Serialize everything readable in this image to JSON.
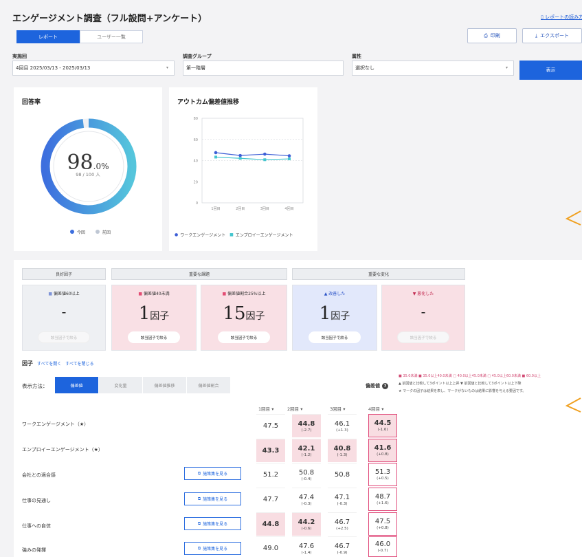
{
  "header": {
    "title": "エンゲージメント調査（フル設問+アンケート）",
    "guide_link": "レポートの読み方"
  },
  "view_tabs": [
    "レポート",
    "ユーザー一覧"
  ],
  "toolbar": {
    "print": "印刷",
    "export": "エクスポート"
  },
  "filters": {
    "round": {
      "label": "実施回",
      "value": "4回目 2025/03/13 - 2025/03/13"
    },
    "group": {
      "label": "調査グループ",
      "value": "第一階層"
    },
    "attr": {
      "label": "属性",
      "value": "選択なし"
    },
    "show_button": "表示"
  },
  "response_rate": {
    "title": "回答率",
    "value": "98",
    "unit": ".0%",
    "sub": "98 / 100 人",
    "rate": 0.98,
    "legend": [
      "今回",
      "前回"
    ],
    "colors": {
      "current": "#3d6fde",
      "previous": "#bfc7d4"
    }
  },
  "trend": {
    "title": "アウトカム偏差値推移",
    "legend": [
      "ワークエンゲージメント",
      "エンプロイーエンゲージメント"
    ]
  },
  "chart_data": {
    "type": "line",
    "title": "アウトカム偏差値推移",
    "categories": [
      "1回目",
      "2回目",
      "3回目",
      "4回目"
    ],
    "ylim": [
      0,
      80
    ],
    "yticks": [
      "0",
      "20",
      "40",
      "60",
      "80"
    ],
    "grid": false,
    "legend_position": "bottom",
    "series": [
      {
        "name": "ワークエンゲージメント",
        "values": [
          47.5,
          44.8,
          46.1,
          44.5
        ],
        "color": "#3d5fd6"
      },
      {
        "name": "エンプロイーエンゲージメント",
        "values": [
          43.3,
          42.1,
          40.8,
          41.6
        ],
        "color": "#46c6cf"
      }
    ]
  },
  "summary": {
    "groups": [
      "良好因子",
      "重要な課題",
      "重要な変化"
    ],
    "boxes": [
      {
        "label": "偏差値60以上",
        "value": "-",
        "unit": "",
        "button": "該当因子で絞る"
      },
      {
        "label": "偏差値40未満",
        "value": "1",
        "unit": "因子",
        "button": "該当因子で絞る"
      },
      {
        "label": "偏差値割合25%以上",
        "value": "15",
        "unit": "因子",
        "button": "該当因子で絞る"
      },
      {
        "label": "▲ 改善した",
        "value": "1",
        "unit": "因子",
        "button": "該当因子で絞る"
      },
      {
        "label": "▼ 悪化した",
        "value": "-",
        "unit": "",
        "button": "該当因子で絞る"
      }
    ]
  },
  "factors": {
    "title": "因子",
    "open_all": "すべてを開く",
    "close_all": "すべてを閉じる",
    "display_label": "表示方法：",
    "modes": [
      "偏差値",
      "変化量",
      "偏差値推移",
      "偏差値割合"
    ],
    "metric_label": "偏差値",
    "legend_line1": "■ 35.0未満 ■ 35.0以上40.0未満 □ 40.0以上45.0未満 □ 45.0以上60.0未満 ■ 60.0以上",
    "legend_line2": "▲ 前回値と比較して3ポイント以上上昇 ▼ 前回値と比較して3ポイント以上下降",
    "legend_line3": "★ マークの因子は結果を表し、マークがないものは結果に影響を与える要因です。",
    "measure_button": "施策集を見る",
    "columns": [
      "1回目 ▾",
      "2回目 ▾",
      "3回目 ▾",
      "4回目 ▾"
    ],
    "rows": [
      {
        "label": "ワークエンゲージメント（★）",
        "button": false,
        "cells": [
          {
            "v": "47.5",
            "d": ""
          },
          {
            "v": "44.8",
            "d": "(-2.7)"
          },
          {
            "v": "46.1",
            "d": "(+1.3)"
          },
          {
            "v": "44.5",
            "d": "(-1.6)"
          }
        ]
      },
      {
        "label": "エンプロイーエンゲージメント（★）",
        "button": false,
        "cells": [
          {
            "v": "43.3",
            "d": ""
          },
          {
            "v": "42.1",
            "d": "(-1.2)"
          },
          {
            "v": "40.8",
            "d": "(-1.3)"
          },
          {
            "v": "41.6",
            "d": "(+0.8)"
          }
        ]
      },
      {
        "label": "会社との適合感",
        "button": true,
        "cells": [
          {
            "v": "51.2",
            "d": ""
          },
          {
            "v": "50.8",
            "d": "(-0.4)"
          },
          {
            "v": "50.8",
            "d": ""
          },
          {
            "v": "51.3",
            "d": "(+0.5)"
          }
        ]
      },
      {
        "label": "仕事の見通し",
        "button": true,
        "cells": [
          {
            "v": "47.7",
            "d": ""
          },
          {
            "v": "47.4",
            "d": "(-0.3)"
          },
          {
            "v": "47.1",
            "d": "(-0.3)"
          },
          {
            "v": "48.7",
            "d": "(+1.6)"
          }
        ]
      },
      {
        "label": "仕事への自信",
        "button": true,
        "cells": [
          {
            "v": "44.8",
            "d": ""
          },
          {
            "v": "44.2",
            "d": "(-0.6)"
          },
          {
            "v": "46.7",
            "d": "(+2.5)"
          },
          {
            "v": "47.5",
            "d": "(+0.8)"
          }
        ]
      },
      {
        "label": "強みの発揮",
        "button": true,
        "cells": [
          {
            "v": "49.0",
            "d": ""
          },
          {
            "v": "47.6",
            "d": "(-1.4)"
          },
          {
            "v": "46.7",
            "d": "(-0.9)"
          },
          {
            "v": "46.0",
            "d": "(-0.7)"
          }
        ]
      }
    ]
  }
}
